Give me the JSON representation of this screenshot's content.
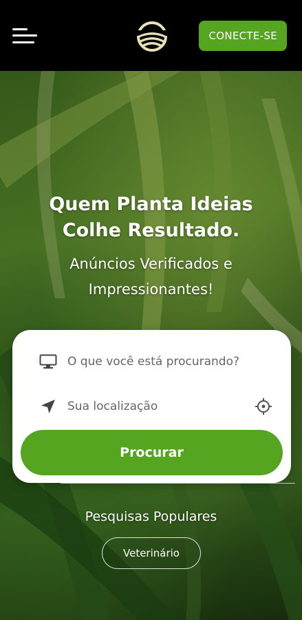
{
  "header": {
    "menu_icon": "hamburger-menu-icon",
    "logo_icon": "farm-field-logo-icon",
    "connect_label": "CONECTE-SE"
  },
  "hero": {
    "title_line1": "Quem Planta Ideias",
    "title_line2": "Colhe Resultado.",
    "subtitle_line1": "Anúncios Verificados e",
    "subtitle_line2": "Impressionantes!"
  },
  "search": {
    "what_placeholder": "O que você está procurando?",
    "what_icon": "monitor-icon",
    "location_placeholder": "Sua localização",
    "location_icon": "location-arrow-icon",
    "target_icon": "crosshair-icon",
    "button_label": "Procurar"
  },
  "popular": {
    "title": "Pesquisas Populares",
    "items": [
      "Veterinário"
    ]
  },
  "colors": {
    "accent": "#56a520",
    "header_bg": "#000000",
    "logo": "#e8e2b8"
  }
}
